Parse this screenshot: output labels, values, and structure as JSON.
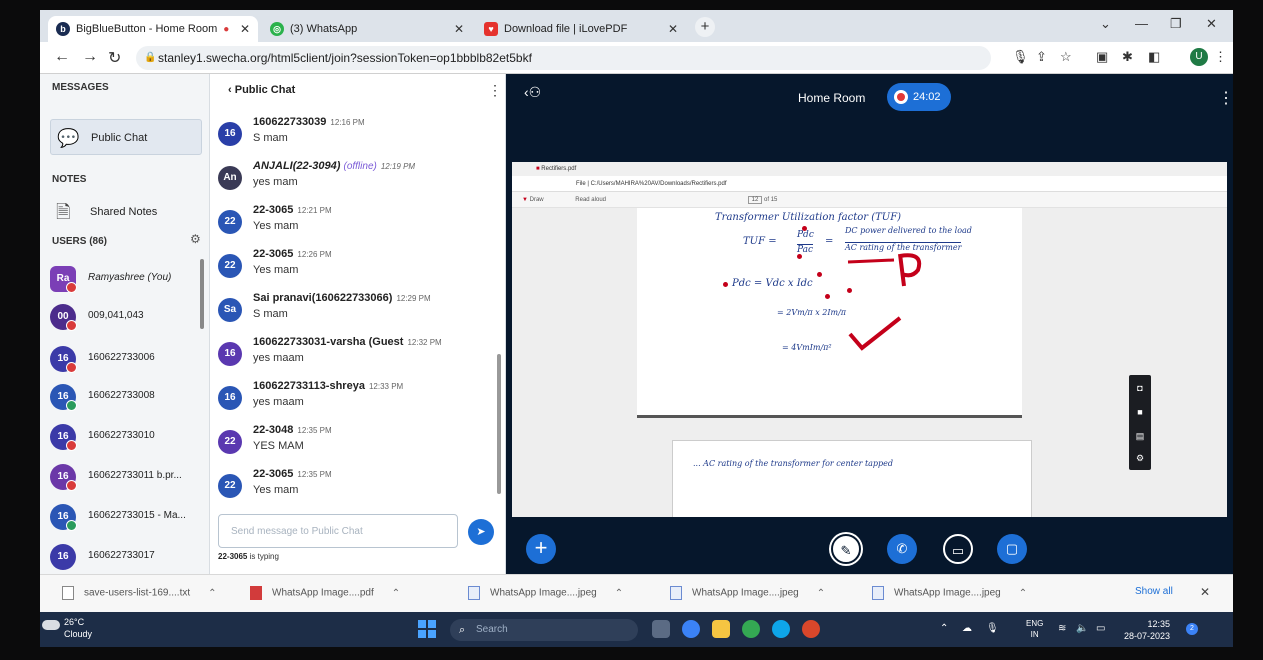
{
  "browser": {
    "tabs": [
      {
        "title": "BigBlueButton - Home Room",
        "favicon": "bbb"
      },
      {
        "title": "(3) WhatsApp",
        "favicon": "whatsapp"
      },
      {
        "title": "Download file | iLovePDF",
        "favicon": "ilovepdf"
      }
    ],
    "url": "stanley1.swecha.org/html5client/join?sessionToken=op1bbblb82et5bkf",
    "profile_initial": "U"
  },
  "sidebar": {
    "messages_heading": "MESSAGES",
    "public_chat_label": "Public Chat",
    "notes_heading": "NOTES",
    "shared_notes_label": "Shared Notes",
    "users_heading": "USERS (86)",
    "users": [
      {
        "initials": "Ra",
        "name": "Ramyashree (You)",
        "color": "#7b3fb6"
      },
      {
        "initials": "00",
        "name": "009,041,043",
        "color": "#4c2c8c"
      },
      {
        "initials": "16",
        "name": "160622733006",
        "color": "#3b3aa8"
      },
      {
        "initials": "16",
        "name": "160622733008",
        "color": "#2a56b5"
      },
      {
        "initials": "16",
        "name": "160622733010",
        "color": "#3b3aa8"
      },
      {
        "initials": "16",
        "name": "160622733011 b.pr...",
        "color": "#6b38a8"
      },
      {
        "initials": "16",
        "name": "160622733015 - Ma...",
        "color": "#2a56b5"
      },
      {
        "initials": "16",
        "name": "160622733017",
        "color": "#3b3aa8"
      }
    ]
  },
  "chat": {
    "title": "Public Chat",
    "messages": [
      {
        "initials": "16",
        "name": "160622733039",
        "time": "12:16 PM",
        "text": "S mam",
        "offline": "",
        "color": "#2a3fa8"
      },
      {
        "initials": "An",
        "name": "ANJALI(22-3094)",
        "time": "12:19 PM",
        "text": "yes mam",
        "offline": "(offline)",
        "color": "#3a3a56"
      },
      {
        "initials": "22",
        "name": "22-3065",
        "time": "12:21 PM",
        "text": "Yes mam",
        "offline": "",
        "color": "#2a56b5"
      },
      {
        "initials": "22",
        "name": "22-3065",
        "time": "12:26 PM",
        "text": "Yes mam",
        "offline": "",
        "color": "#2a56b5"
      },
      {
        "initials": "Sa",
        "name": "Sai pranavi(160622733066)",
        "time": "12:29 PM",
        "text": "S mam",
        "offline": "",
        "color": "#2a56b5"
      },
      {
        "initials": "16",
        "name": "160622733031-varsha (Guest",
        "time": "12:32 PM",
        "text": "yes maam",
        "offline": "",
        "color": "#5a38b0"
      },
      {
        "initials": "16",
        "name": "160622733113-shreya",
        "time": "12:33 PM",
        "text": "yes maam",
        "offline": "",
        "color": "#2a56b5"
      },
      {
        "initials": "22",
        "name": "22-3048",
        "time": "12:35 PM",
        "text": "YES MAM",
        "offline": "",
        "color": "#5a38b0"
      },
      {
        "initials": "22",
        "name": "22-3065",
        "time": "12:35 PM",
        "text": "Yes mam",
        "offline": "",
        "color": "#2a56b5"
      }
    ],
    "input_placeholder": "Send message to Public Chat",
    "typing_user": "22-3065",
    "typing_suffix": "is typing"
  },
  "presentation": {
    "room_title": "Home Room",
    "recording_time": "24:02",
    "pdf_tab_title": "Rectifiers.pdf",
    "pdf_url": "C:/Users/MAHIRA%20AV/Downloads/Rectifiers.pdf",
    "pdf_file_label": "File",
    "pdf_toolbar": {
      "draw": "Draw",
      "read": "Read aloud",
      "page": "12",
      "of": "of 15"
    },
    "handwriting": {
      "line1": "Transformer Utilization factor (TUF)",
      "tuf": "TUF =",
      "frac_num": "Pdc",
      "frac_den": "Pac",
      "eq": "=",
      "desc1": "DC power delivered to the load",
      "desc2": "AC rating of the transformer",
      "pdc": "Pdc = Vdc x Idc",
      "step2": "= 2Vm/π x 2Im/π",
      "step3": "= 4VmIm/π²",
      "page2_text": "... AC rating of the transformer for center tapped"
    }
  },
  "downloads": [
    {
      "name": "save-users-list-169....txt",
      "kind": "txt"
    },
    {
      "name": "WhatsApp Image....pdf",
      "kind": "pdf"
    },
    {
      "name": "WhatsApp Image....jpeg",
      "kind": "img"
    },
    {
      "name": "WhatsApp Image....jpeg",
      "kind": "img"
    },
    {
      "name": "WhatsApp Image....jpeg",
      "kind": "img"
    }
  ],
  "downloads_show_all": "Show all",
  "taskbar": {
    "temp": "26°C",
    "weather": "Cloudy",
    "search_placeholder": "Search",
    "lang1": "ENG",
    "lang2": "IN",
    "time": "12:35",
    "date": "28-07-2023",
    "notification_count": "2"
  }
}
